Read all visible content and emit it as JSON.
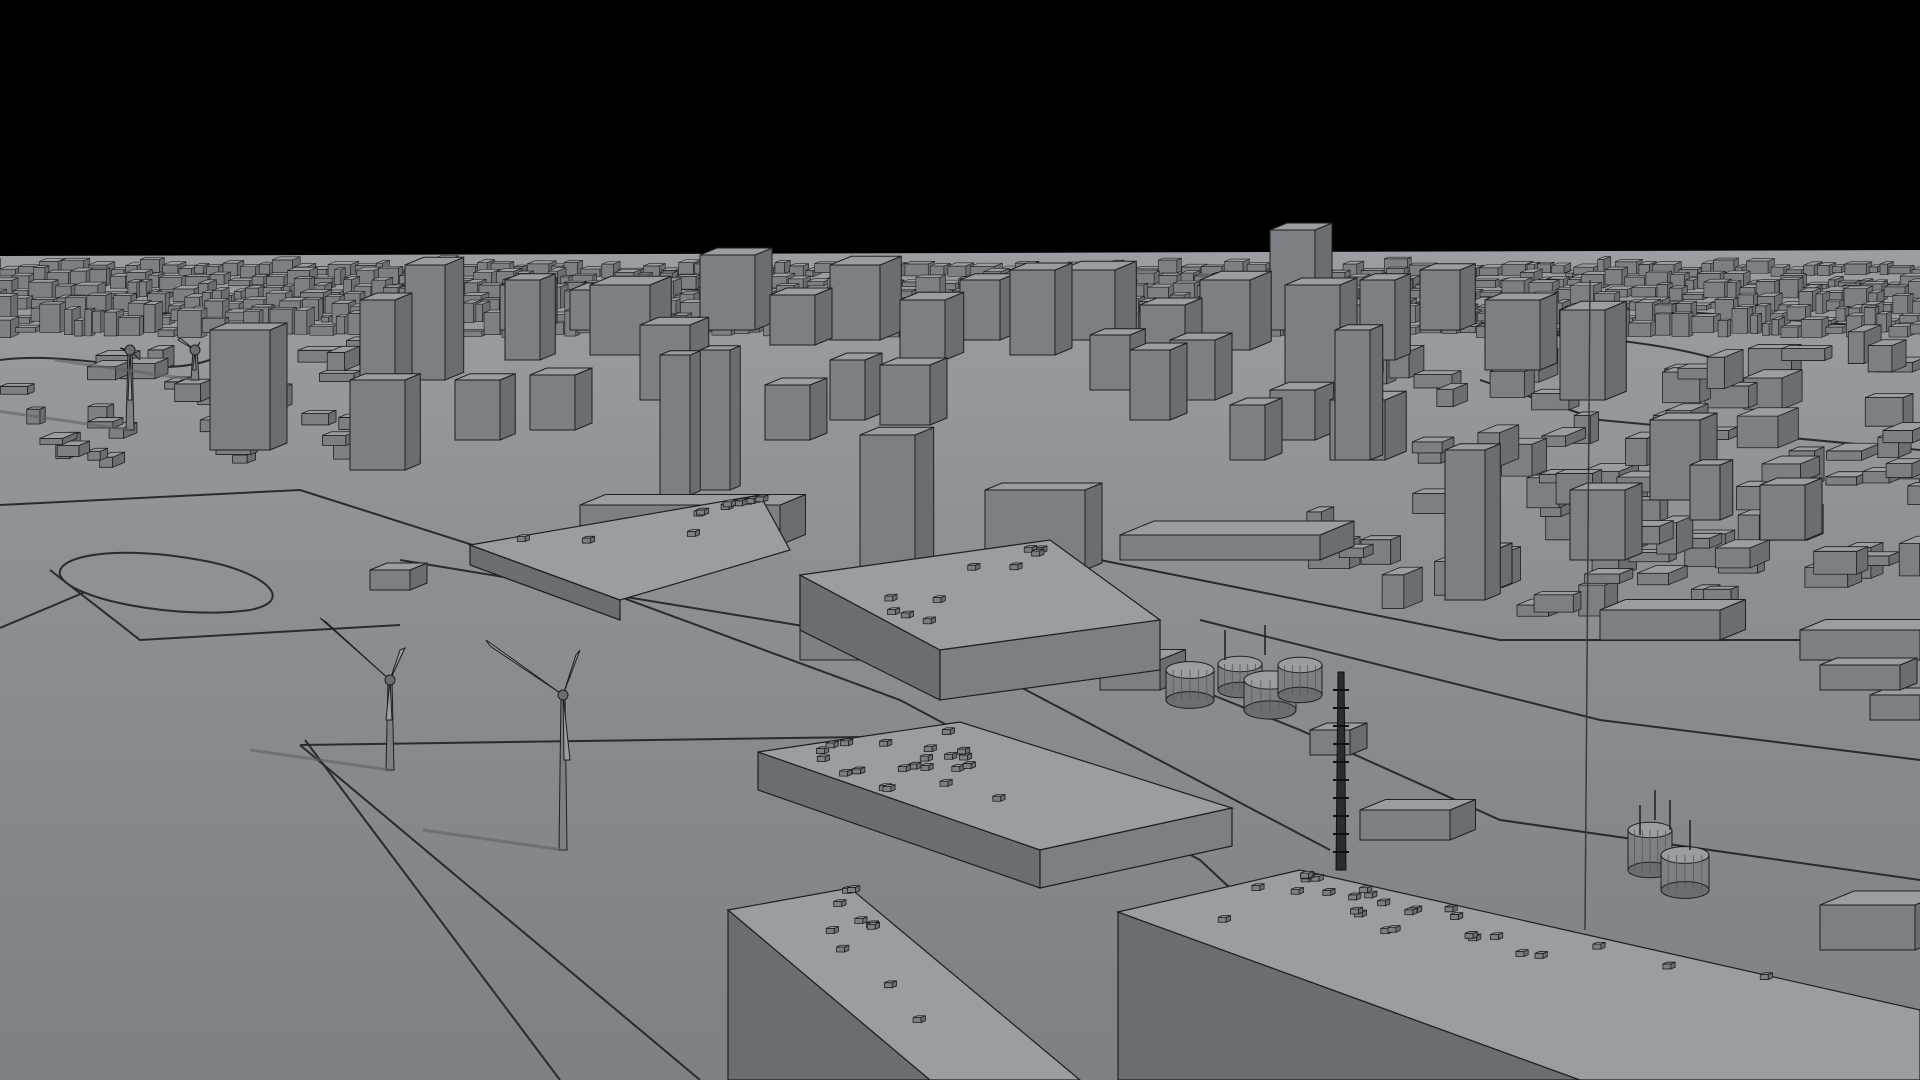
{
  "scene": {
    "kind": "3d-city-clay-render",
    "sky_color": "#000000",
    "ground_color": "#8a8d91",
    "building_colors": {
      "top": "#9a9da1",
      "left": "#7c7f83",
      "right": "#6a6d71"
    },
    "edge_color": "#1e1f21",
    "elements": [
      "skyline-towers",
      "distant-city-blocks",
      "foreground-warehouses",
      "wind-turbines",
      "storage-tanks",
      "transmission-mast",
      "roads"
    ]
  }
}
